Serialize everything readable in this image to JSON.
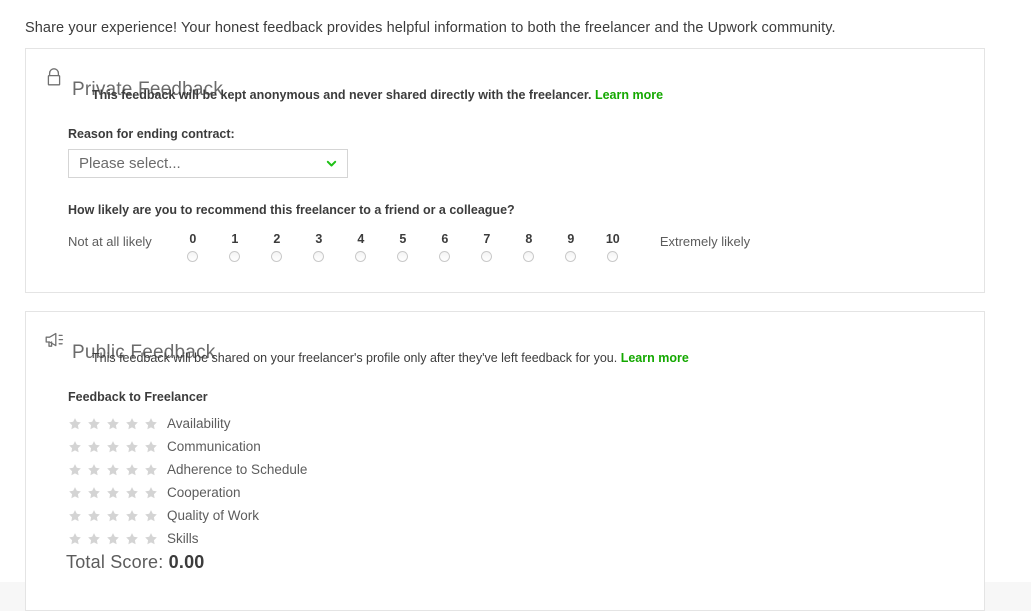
{
  "page": {
    "intro": "Share your experience! Your honest feedback provides helpful information to both the freelancer and the Upwork community."
  },
  "colors": {
    "brand_green": "#14a800",
    "page_background": "#ffffff",
    "card_border": "#e4e4e4",
    "star_empty": "#d4d4d4",
    "text_primary": "#3c3c3c",
    "text_muted": "#6b6b6b"
  },
  "private_feedback": {
    "icon": "lock-icon",
    "title": "Private Feedback",
    "description": "This feedback will be kept anonymous and never shared directly with the freelancer.",
    "learn_more": "Learn more",
    "reason_label": "Reason for ending contract:",
    "reason_select": {
      "value": "Please select...",
      "placeholder": "Please select...",
      "chevron": "chevron-down-icon"
    },
    "nps": {
      "question": "How likely are you to recommend this freelancer to a friend or a colleague?",
      "low_label": "Not at all likely",
      "high_label": "Extremely likely",
      "options": [
        "0",
        "1",
        "2",
        "3",
        "4",
        "5",
        "6",
        "7",
        "8",
        "9",
        "10"
      ],
      "selected": null
    }
  },
  "public_feedback": {
    "icon": "megaphone-icon",
    "title": "Public Feedback",
    "description": "This feedback will be shared on your freelancer's profile only after they've left feedback for you.",
    "learn_more": "Learn more",
    "section_label": "Feedback to Freelancer",
    "max_stars": 5,
    "ratings": [
      {
        "name": "Availability",
        "value": 0
      },
      {
        "name": "Communication",
        "value": 0
      },
      {
        "name": "Adherence to Schedule",
        "value": 0
      },
      {
        "name": "Cooperation",
        "value": 0
      },
      {
        "name": "Quality of Work",
        "value": 0
      },
      {
        "name": "Skills",
        "value": 0
      }
    ],
    "total_score_label": "Total Score:",
    "total_score_value": "0.00"
  }
}
